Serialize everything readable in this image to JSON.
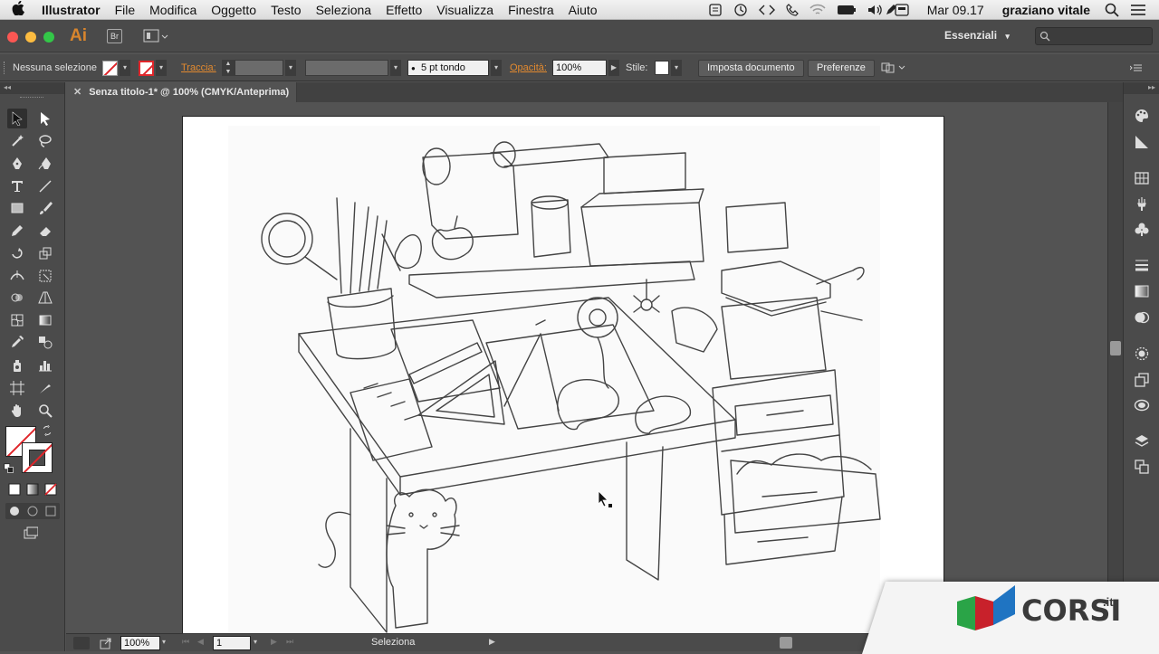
{
  "menubar": {
    "app_name": "Illustrator",
    "items": [
      "File",
      "Modifica",
      "Oggetto",
      "Testo",
      "Seleziona",
      "Effetto",
      "Visualizza",
      "Finestra",
      "Aiuto"
    ],
    "clock": "Mar 09.17",
    "user": "graziano vitale"
  },
  "app_bar": {
    "logo": "Ai",
    "bridge": "Br",
    "workspace": "Essenziali"
  },
  "control_bar": {
    "selection": "Nessuna selezione",
    "stroke_label": "Traccia:",
    "brush": "5 pt tondo",
    "opacity_label": "Opacità:",
    "opacity_value": "100%",
    "style_label": "Stile:",
    "doc_setup": "Imposta documento",
    "preferences": "Preferenze"
  },
  "document": {
    "tab_title": "Senza titolo-1* @ 100% (CMYK/Anteprima)"
  },
  "status_bar": {
    "zoom": "100%",
    "page": "1",
    "tool": "Seleziona"
  },
  "branding": {
    "name": "CORSI",
    "suffix": ".it"
  }
}
